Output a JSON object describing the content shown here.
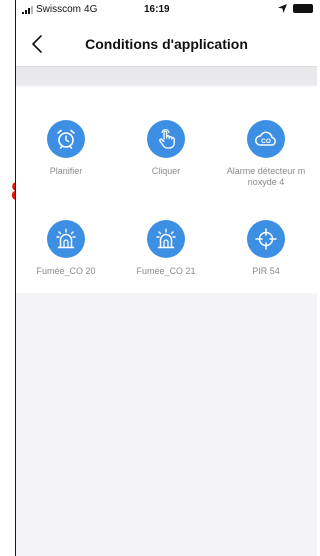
{
  "status_bar": {
    "carrier": "Swisscom",
    "network": "4G",
    "time": "16:19"
  },
  "navbar": {
    "title": "Conditions d'application",
    "back_icon": "chevron-left-icon"
  },
  "conditions": [
    {
      "label": "Planifier",
      "icon": "alarm-clock-icon"
    },
    {
      "label": "Cliquer",
      "icon": "hand-tap-icon"
    },
    {
      "label": "Alarme détecteur m noxyde 4",
      "icon": "co-cloud-icon"
    },
    {
      "label": "Fumée_CO 20",
      "icon": "siren-icon"
    },
    {
      "label": "Fumée_CO 21",
      "icon": "siren-icon"
    },
    {
      "label": "PIR 54",
      "icon": "crosshair-icon"
    }
  ],
  "annotation": {
    "number": "8",
    "color": "#e0140c"
  },
  "colors": {
    "accent": "#3d8fe3",
    "background": "#f4f4f6"
  }
}
